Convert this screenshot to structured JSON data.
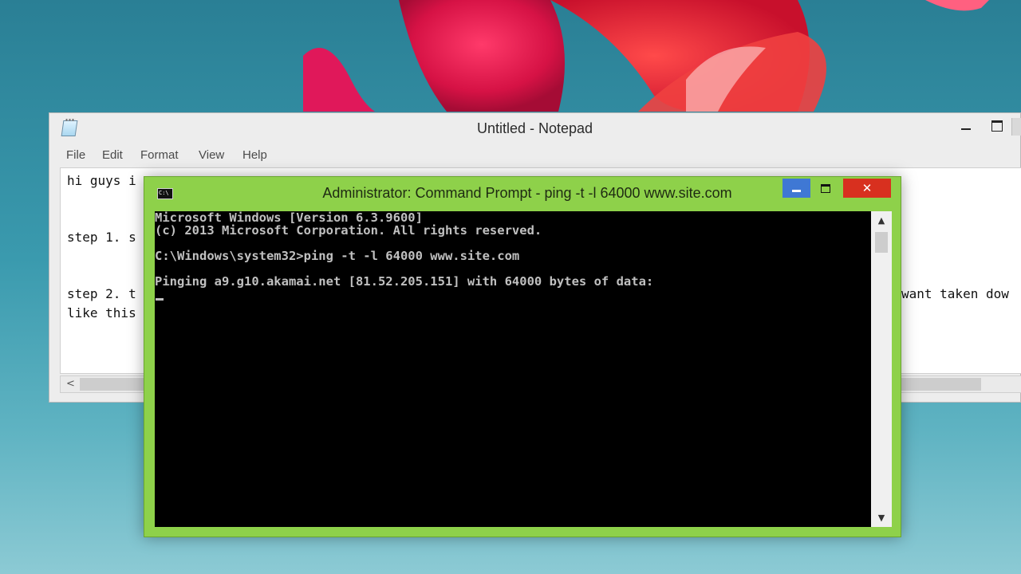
{
  "notepad": {
    "title": "Untitled - Notepad",
    "menu": [
      "File",
      "Edit",
      "Format",
      "View",
      "Help"
    ],
    "lines": {
      "line1": "hi guys i",
      "line2": "step 1. s",
      "line3_start": "step 2. t",
      "line3_end": "want taken dow",
      "line4": "like this"
    },
    "scroll_left": "<"
  },
  "cmd": {
    "title": "Administrator: Command Prompt - ping  -t -l 64000 www.site.com",
    "icon_text": "C:\\",
    "close_glyph": "✕",
    "scroll_up": "▲",
    "scroll_down": "▼",
    "lines": [
      "Microsoft Windows [Version 6.3.9600]",
      "(c) 2013 Microsoft Corporation. All rights reserved.",
      "",
      "C:\\Windows\\system32>ping -t -l 64000 www.site.com",
      "",
      "Pinging a9.g10.akamai.net [81.52.205.151] with 64000 bytes of data:"
    ]
  },
  "colors": {
    "cmd_frame": "#8ed14a",
    "cmd_minimize": "#3f78d4",
    "cmd_close": "#d8301f",
    "console_bg": "#000000",
    "console_fg": "#c0c0c0",
    "desktop_teal": "#2a7f95",
    "flower_pink": "#e0184a"
  }
}
